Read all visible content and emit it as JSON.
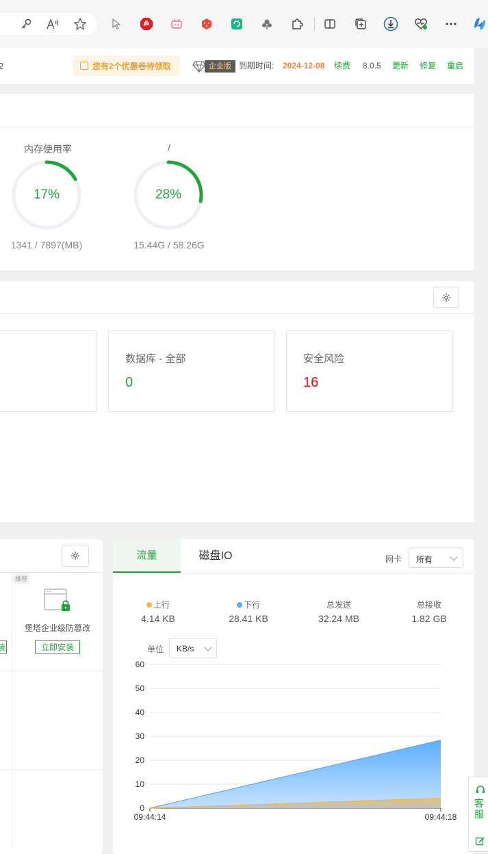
{
  "toolbar_icons": [
    "key-icon",
    "read-aloud-icon",
    "favorite-star-icon",
    "cursor-icon",
    "adblock-hand-icon",
    "bilibili-icon",
    "dice-extension-icon",
    "refresh-extension-icon",
    "tree-extension-icon",
    "puzzle-extensions-icon",
    "split-screen-icon",
    "collections-icon",
    "download-icon",
    "health-icon",
    "more-menu-icon",
    "copilot-icon"
  ],
  "top_bar": {
    "left_fragment": "2",
    "coupon": "您有2个优惠卷待领取",
    "edition": "企业版",
    "expire_label": "到期时间:",
    "expire_date": "2024-12-08",
    "renew": "续费",
    "version": "8.0.5",
    "update": "更新",
    "repair": "修复",
    "restart": "重启"
  },
  "status": {
    "gauges": [
      {
        "title": "内存使用率",
        "percent_text": "17%",
        "percent": 17,
        "detail": "1341 / 7897(MB)"
      },
      {
        "title": "/",
        "percent_text": "28%",
        "percent": 28,
        "detail": "15.44G / 58.26G"
      }
    ]
  },
  "overview": {
    "cards": [
      {
        "label": "数据库 - 全部",
        "value": "0"
      },
      {
        "label": "安全风险",
        "value": "16"
      }
    ]
  },
  "software": {
    "recommend_tag": "推荐",
    "app_name": "堡塔企业级防篡改",
    "install_label": "立即安装",
    "partial_button": "装"
  },
  "traffic": {
    "tabs": [
      "流量",
      "磁盘IO"
    ],
    "nic_label": "网卡",
    "nic_value": "所有",
    "stats": [
      {
        "label": "上行",
        "value": "4.14 KB",
        "dot_color": "#f3b542"
      },
      {
        "label": "下行",
        "value": "28.41 KB",
        "dot_color": "#52a9ff"
      },
      {
        "label": "总发送",
        "value": "32.24 MB"
      },
      {
        "label": "总接收",
        "value": "1.82 GB"
      }
    ],
    "unit_label": "单位",
    "unit_value": "KB/s"
  },
  "chart_data": {
    "type": "area",
    "x": [
      "09:44:14",
      "09:44:18"
    ],
    "yticks": [
      0,
      10,
      20,
      30,
      40,
      50,
      60
    ],
    "ylim": [
      0,
      60
    ],
    "grid": true,
    "series": [
      {
        "name": "上行",
        "values": [
          0,
          4.14
        ],
        "color": "#f3b542"
      },
      {
        "name": "下行",
        "values": [
          0,
          28.41
        ],
        "color": "#52a9ff"
      }
    ]
  },
  "cs_widget": {
    "label": "客服"
  },
  "colors": {
    "accent": "#20a53a",
    "danger": "#ff0000",
    "orange": "#f0883a",
    "coupon": "#e5a23a"
  }
}
